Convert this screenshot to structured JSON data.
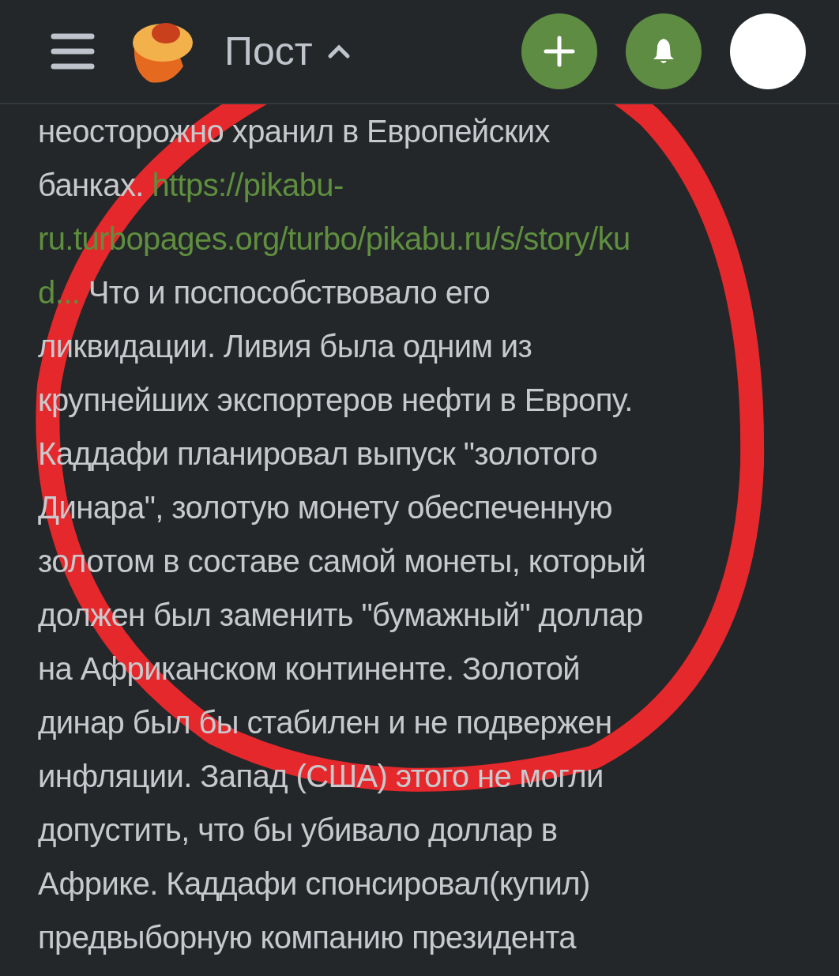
{
  "header": {
    "title": "Пост"
  },
  "lines": [
    [
      {
        "kind": "text",
        "text": "неосторожно хранил в Европейских"
      }
    ],
    [
      {
        "kind": "text",
        "text": "банках. "
      },
      {
        "kind": "link",
        "text": "https://pikabu-"
      }
    ],
    [
      {
        "kind": "link",
        "text": "ru.turbopages.org/turbo/pikabu.ru/s/story/ku"
      }
    ],
    [
      {
        "kind": "link",
        "text": "d..."
      },
      {
        "kind": "text",
        "text": " Что и поспособствовало его"
      }
    ],
    [
      {
        "kind": "text",
        "text": "ликвидации. Ливия была одним из"
      }
    ],
    [
      {
        "kind": "text",
        "text": "крупнейших экспортеров нефти в Европу."
      }
    ],
    [
      {
        "kind": "text",
        "text": "Каддафи планировал выпуск \"золотого"
      }
    ],
    [
      {
        "kind": "text",
        "text": "Динара\", золотую монету обеспеченную"
      }
    ],
    [
      {
        "kind": "text",
        "text": "золотом в составе самой монеты, который"
      }
    ],
    [
      {
        "kind": "text",
        "text": "должен был заменить \"бумажный\" доллар"
      }
    ],
    [
      {
        "kind": "text",
        "text": "на Африканском континенте. Золотой"
      }
    ],
    [
      {
        "kind": "text",
        "text": "динар был бы стабилен и не подвержен"
      }
    ],
    [
      {
        "kind": "text",
        "text": "инфляции. Запад (США) этого не могли"
      }
    ],
    [
      {
        "kind": "text",
        "text": "допустить, что бы убивало доллар в"
      }
    ],
    [
      {
        "kind": "text",
        "text": "Африке. Каддафи спонсировал(купил)"
      }
    ],
    [
      {
        "kind": "text",
        "text": "предвыборную компанию президента"
      }
    ]
  ]
}
